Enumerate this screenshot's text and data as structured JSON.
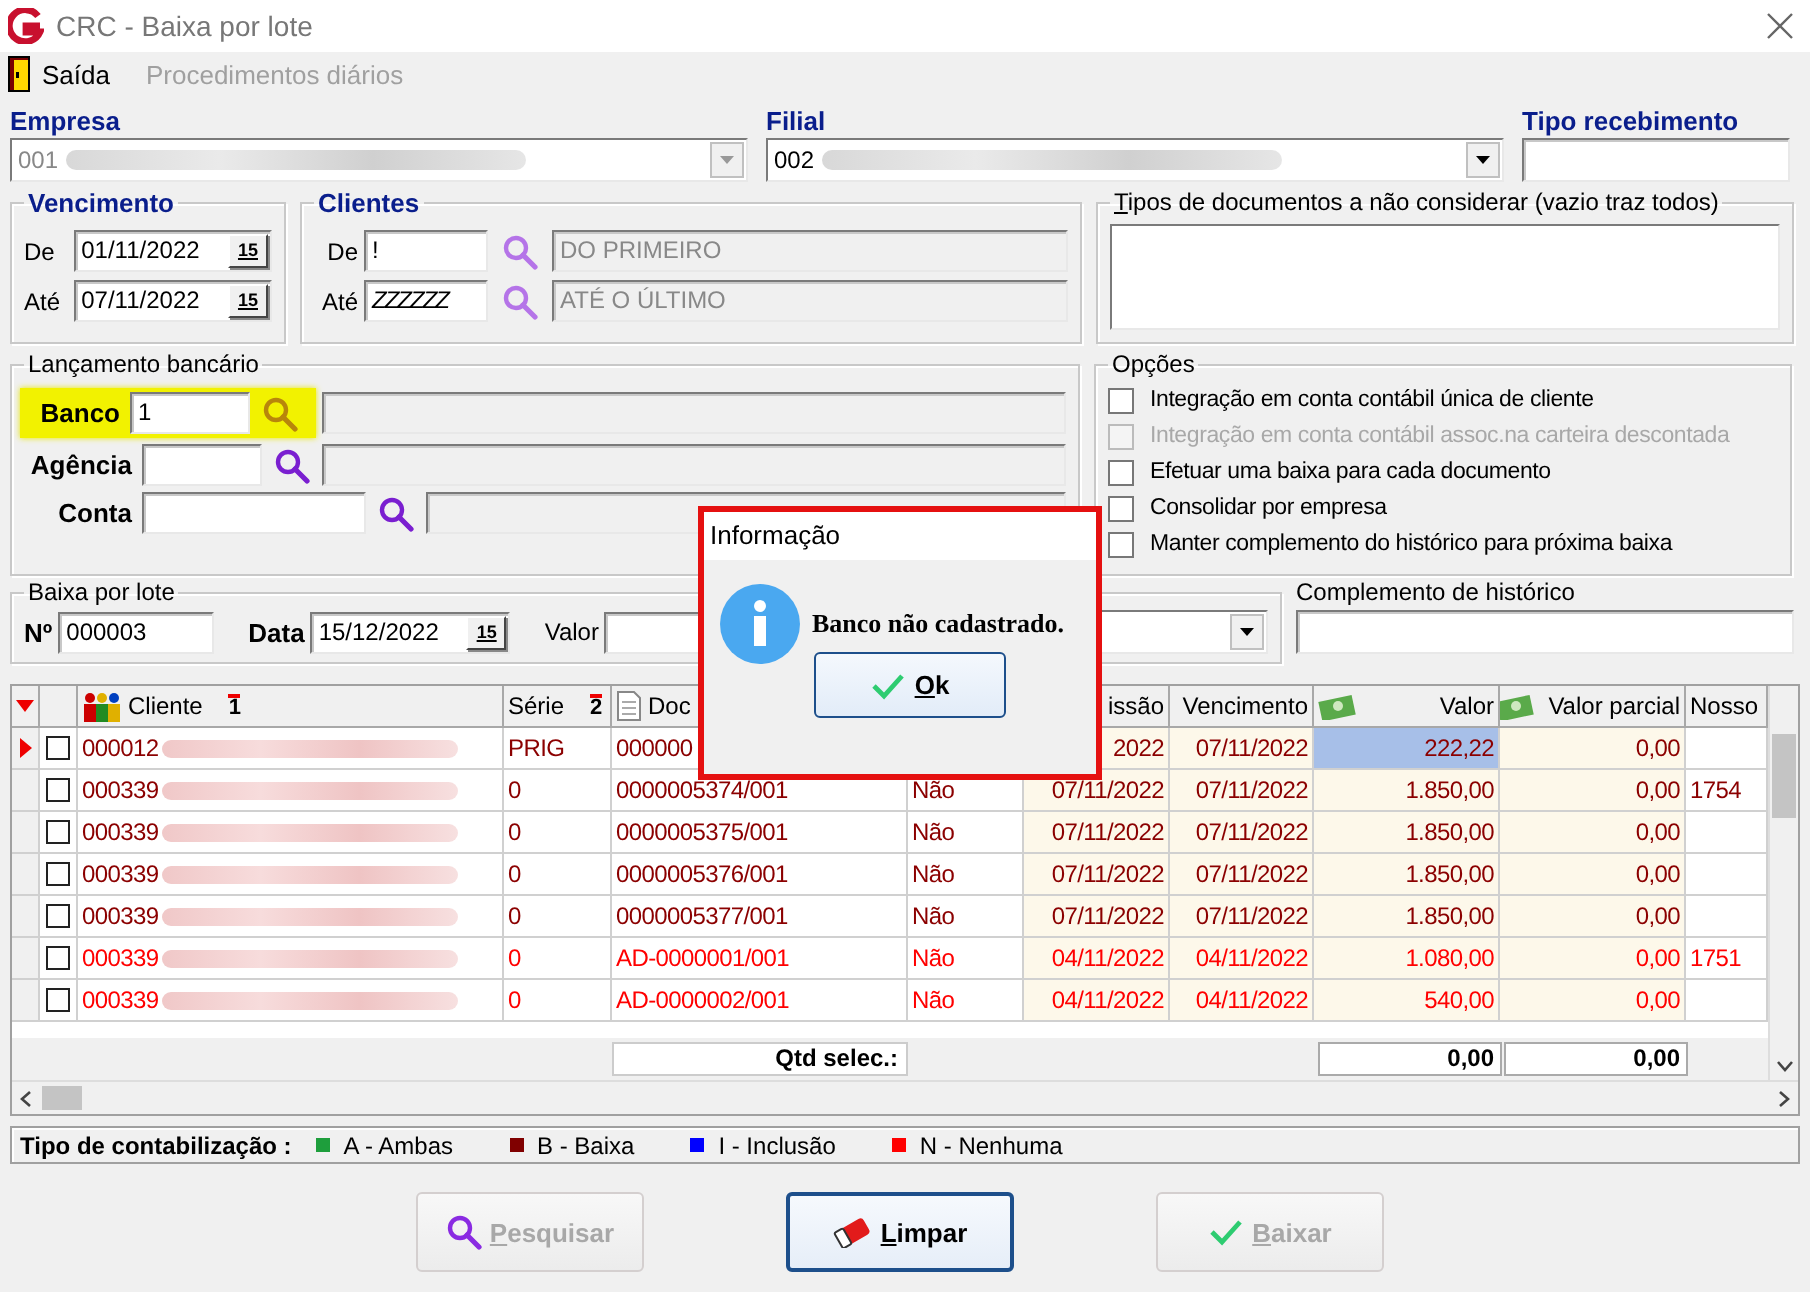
{
  "window": {
    "title": "CRC - Baixa por lote"
  },
  "menu": [
    {
      "label": "Saída",
      "disabled": false
    },
    {
      "label": "Procedimentos diários",
      "disabled": true
    }
  ],
  "empresa": {
    "label": "Empresa",
    "value": "001",
    "disabled": true
  },
  "filial": {
    "label": "Filial",
    "value": "002",
    "disabled": false
  },
  "tipo_recebimento": {
    "label": "Tipo recebimento"
  },
  "vencimento": {
    "title": "Vencimento",
    "from_label": "De",
    "from": "01/11/2022",
    "from_button": "15",
    "to_label": "Até",
    "to": "07/11/2022",
    "to_button": "15"
  },
  "clientes": {
    "title": "Clientes",
    "from_label": "De",
    "from": "!",
    "from_name": "DO PRIMEIRO",
    "to_label": "Até",
    "to": "ZZZZZZ",
    "to_name": "ATÉ O ÚLTIMO"
  },
  "tipos_documentos": {
    "label": "Tipos de documentos a não considerar (vazio traz todos)"
  },
  "lancamento": {
    "title": "Lançamento bancário",
    "fields": [
      {
        "label": "Banco",
        "value": "1",
        "highlighted": true,
        "kind": "short"
      },
      {
        "label": "Agência",
        "highlighted": false,
        "kind": "short"
      },
      {
        "label": "Conta",
        "highlighted": false,
        "kind": "long"
      }
    ]
  },
  "opcoes": {
    "title": "Opções",
    "items": [
      {
        "label": "Integração em conta contábil única de cliente",
        "checked": false,
        "disabled": false
      },
      {
        "label": "Integração em conta contábil assoc.na carteira descontada",
        "checked": false,
        "disabled": true
      },
      {
        "label": "Efetuar uma baixa para cada documento",
        "checked": false,
        "disabled": false
      },
      {
        "label": "Consolidar por empresa",
        "checked": false,
        "disabled": false
      },
      {
        "label": "Manter complemento do histórico para próxima baixa",
        "checked": false,
        "disabled": false
      }
    ]
  },
  "baixa": {
    "title": "Baixa por lote",
    "number_label": "Nº",
    "number": "000003",
    "date_label": "Data",
    "date": "15/12/2022",
    "date_button": "15",
    "value_label": "Valor"
  },
  "complemento": {
    "label": "Complemento de histórico"
  },
  "grid": {
    "columns": [
      {
        "label": "Cliente",
        "kind": "client",
        "sort": "1"
      },
      {
        "label": "Série",
        "kind": "text",
        "sort": "2"
      },
      {
        "label": "Doc",
        "kind": "document"
      },
      {
        "kind": "text"
      },
      {
        "label": "issão",
        "kind": "date"
      },
      {
        "label": "Vencimento",
        "kind": "date"
      },
      {
        "label": "Valor",
        "kind": "amount"
      },
      {
        "label": "Valor parcial",
        "kind": "amount"
      },
      {
        "label": "Nosso",
        "kind": "text"
      }
    ],
    "rows": [
      {
        "selected": true,
        "checked": false,
        "color": "#8b0000",
        "cells": [
          "000012",
          "PRIG",
          "000000",
          null,
          "2022",
          "07/11/2022",
          "222,22",
          "0,00",
          null
        ]
      },
      {
        "selected": false,
        "checked": false,
        "color": "#8b0000",
        "cells": [
          "000339",
          "0",
          "0000005374/001",
          "Não",
          "07/11/2022",
          "07/11/2022",
          "1.850,00",
          "0,00",
          "1754"
        ]
      },
      {
        "selected": false,
        "checked": false,
        "color": "#8b0000",
        "cells": [
          "000339",
          "0",
          "0000005375/001",
          "Não",
          "07/11/2022",
          "07/11/2022",
          "1.850,00",
          "0,00",
          null
        ]
      },
      {
        "selected": false,
        "checked": false,
        "color": "#8b0000",
        "cells": [
          "000339",
          "0",
          "0000005376/001",
          "Não",
          "07/11/2022",
          "07/11/2022",
          "1.850,00",
          "0,00",
          null
        ]
      },
      {
        "selected": false,
        "checked": false,
        "color": "#8b0000",
        "cells": [
          "000339",
          "0",
          "0000005377/001",
          "Não",
          "07/11/2022",
          "07/11/2022",
          "1.850,00",
          "0,00",
          null
        ]
      },
      {
        "selected": false,
        "checked": false,
        "color": "#ff0000",
        "cells": [
          "000339",
          "0",
          "AD-0000001/001",
          "Não",
          "04/11/2022",
          "04/11/2022",
          "1.080,00",
          "0,00",
          "1751"
        ]
      },
      {
        "selected": false,
        "checked": false,
        "color": "#ff0000",
        "cells": [
          "000339",
          "0",
          "AD-0000002/001",
          "Não",
          "04/11/2022",
          "04/11/2022",
          "540,00",
          "0,00",
          null
        ]
      }
    ],
    "totals": {
      "label": "Qtd selec.:",
      "valor": "0,00",
      "valor_parcial": "0,00"
    }
  },
  "legend": {
    "title": "Tipo de contabilização :",
    "items": [
      {
        "label": "A - Ambas",
        "color": "#1e9e3c"
      },
      {
        "label": "B - Baixa",
        "color": "#800000"
      },
      {
        "label": "I - Inclusão",
        "color": "#0000ff"
      },
      {
        "label": "N - Nenhuma",
        "color": "#ff0000"
      }
    ]
  },
  "buttons": [
    {
      "label": "Pesquisar",
      "disabled": true,
      "focused": false
    },
    {
      "label": "Limpar",
      "disabled": false,
      "focused": true
    },
    {
      "label": "Baixar",
      "disabled": true,
      "focused": false
    }
  ],
  "dialog": {
    "title": "Informação",
    "message": "Banco não cadastrado.",
    "button": "Ok"
  }
}
